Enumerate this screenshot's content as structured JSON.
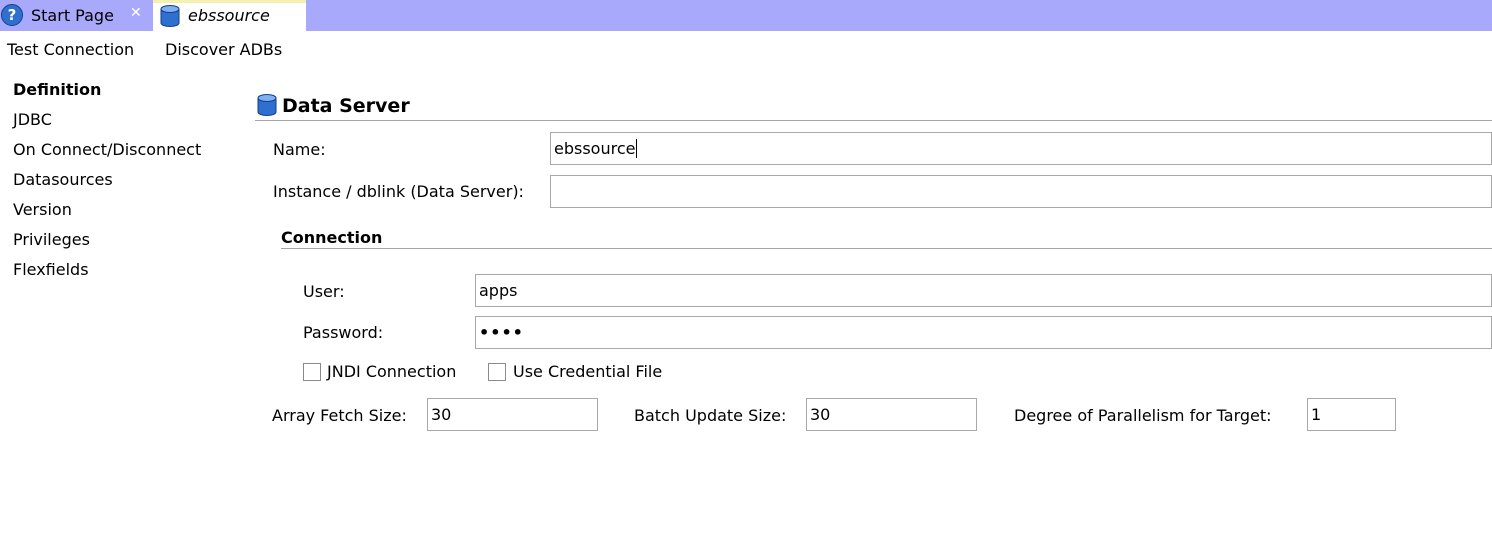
{
  "tabs": [
    {
      "label": "Start Page",
      "icon": "help-icon"
    },
    {
      "label": "ebssource",
      "icon": "database-icon"
    }
  ],
  "toolbar": {
    "test_connection": "Test Connection",
    "discover_adbs": "Discover ADBs"
  },
  "nav": [
    "Definition",
    "JDBC",
    "On Connect/Disconnect",
    "Datasources",
    "Version",
    "Privileges",
    "Flexfields"
  ],
  "section": {
    "title": "Data Server"
  },
  "form": {
    "name_label": "Name:",
    "name_value": "ebssource",
    "instance_label": "Instance / dblink (Data Server):",
    "instance_value": "",
    "connection_title": "Connection",
    "user_label": "User:",
    "user_value": "apps",
    "password_label": "Password:",
    "password_value": "••••",
    "jndi_label": "JNDI Connection",
    "credential_label": "Use Credential File",
    "array_fetch_label": "Array Fetch Size:",
    "array_fetch_value": "30",
    "batch_update_label": "Batch Update Size:",
    "batch_update_value": "30",
    "parallelism_label": "Degree of Parallelism for Target:",
    "parallelism_value": "1"
  },
  "colors": {
    "tabbar": "#a9a9fb",
    "accent": "#2f6fd0"
  }
}
